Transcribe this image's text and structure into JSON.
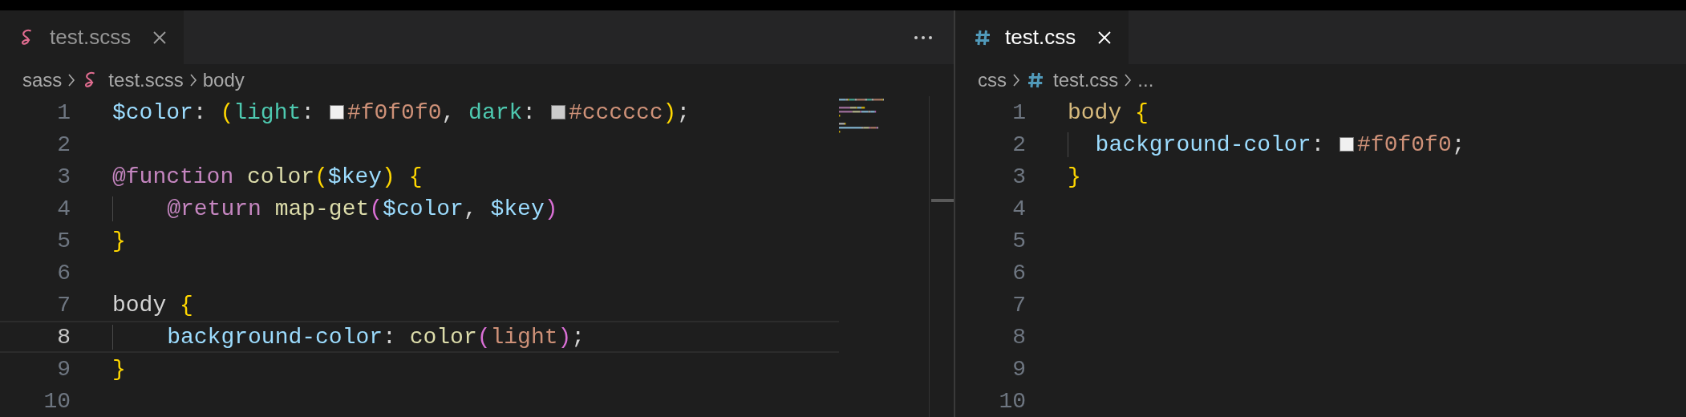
{
  "editor_groups": [
    {
      "focused": false,
      "more_actions": true,
      "minimap": true,
      "tabs": [
        {
          "label": "test.scss",
          "kind": "sass",
          "selected": true
        }
      ],
      "breadcrumbs": [
        {
          "label": "sass",
          "kind": "folder"
        },
        {
          "label": "test.scss",
          "kind": "sass"
        },
        {
          "label": "body",
          "kind": "symbol"
        }
      ],
      "lines": [
        {
          "number": "1",
          "current": false,
          "guide": false,
          "tokens": [
            {
              "kind": "variable",
              "text": "$color"
            },
            {
              "kind": "punct",
              "text": ": "
            },
            {
              "kind": "bracket1",
              "text": "("
            },
            {
              "kind": "mapkey",
              "text": "light"
            },
            {
              "kind": "punct",
              "text": ": "
            },
            {
              "kind": "swatch",
              "color": "#f0f0f0"
            },
            {
              "kind": "value",
              "text": "#f0f0f0"
            },
            {
              "kind": "punct",
              "text": ", "
            },
            {
              "kind": "mapkey",
              "text": "dark"
            },
            {
              "kind": "punct",
              "text": ": "
            },
            {
              "kind": "swatch",
              "color": "#cccccc"
            },
            {
              "kind": "value",
              "text": "#cccccc"
            },
            {
              "kind": "bracket1",
              "text": ")"
            },
            {
              "kind": "punct",
              "text": ";"
            }
          ]
        },
        {
          "number": "2",
          "current": false,
          "guide": false
        },
        {
          "number": "3",
          "current": false,
          "guide": false,
          "tokens": [
            {
              "kind": "atrule",
              "text": "@function "
            },
            {
              "kind": "function",
              "text": "color"
            },
            {
              "kind": "bracket1",
              "text": "("
            },
            {
              "kind": "variable",
              "text": "$key"
            },
            {
              "kind": "bracket1",
              "text": ") {"
            }
          ]
        },
        {
          "number": "4",
          "current": false,
          "guide": true,
          "tokens": [
            {
              "kind": "atrule",
              "text": "    @return "
            },
            {
              "kind": "function",
              "text": "map-get"
            },
            {
              "kind": "bracket2",
              "text": "("
            },
            {
              "kind": "variable",
              "text": "$color"
            },
            {
              "kind": "punct",
              "text": ", "
            },
            {
              "kind": "variable",
              "text": "$key"
            },
            {
              "kind": "bracket2",
              "text": ")"
            }
          ]
        },
        {
          "number": "5",
          "current": false,
          "guide": false,
          "tokens": [
            {
              "kind": "bracket1",
              "text": "}"
            }
          ]
        },
        {
          "number": "6",
          "current": false,
          "guide": false
        },
        {
          "number": "7",
          "current": false,
          "guide": false,
          "tokens": [
            {
              "kind": "plain",
              "text": "body "
            },
            {
              "kind": "bracket1",
              "text": "{"
            }
          ]
        },
        {
          "number": "8",
          "current": true,
          "guide": true,
          "tokens": [
            {
              "kind": "property",
              "text": "    background-color"
            },
            {
              "kind": "punct",
              "text": ": "
            },
            {
              "kind": "function",
              "text": "color"
            },
            {
              "kind": "bracket2",
              "text": "("
            },
            {
              "kind": "value",
              "text": "light"
            },
            {
              "kind": "bracket2",
              "text": ")"
            },
            {
              "kind": "punct",
              "text": ";"
            }
          ]
        },
        {
          "number": "9",
          "current": false,
          "guide": false,
          "tokens": [
            {
              "kind": "bracket1",
              "text": "}"
            }
          ]
        },
        {
          "number": "10",
          "current": false,
          "guide": false
        }
      ]
    },
    {
      "focused": true,
      "more_actions": false,
      "minimap": false,
      "tabs": [
        {
          "label": "test.css",
          "kind": "css",
          "selected": true
        }
      ],
      "breadcrumbs": [
        {
          "label": "css",
          "kind": "folder"
        },
        {
          "label": "test.css",
          "kind": "css"
        },
        {
          "label": "...",
          "kind": "folder"
        }
      ],
      "lines": [
        {
          "number": "1",
          "current": false,
          "guide": false,
          "tokens": [
            {
              "kind": "selector",
              "text": "body "
            },
            {
              "kind": "bracket1",
              "text": "{"
            }
          ]
        },
        {
          "number": "2",
          "current": false,
          "guide": true,
          "tokens": [
            {
              "kind": "property",
              "text": "  background-color"
            },
            {
              "kind": "punct",
              "text": ": "
            },
            {
              "kind": "swatch",
              "color": "#f0f0f0"
            },
            {
              "kind": "value",
              "text": "#f0f0f0"
            },
            {
              "kind": "punct",
              "text": ";"
            }
          ]
        },
        {
          "number": "3",
          "current": false,
          "guide": false,
          "tokens": [
            {
              "kind": "bracket1",
              "text": "}"
            }
          ]
        },
        {
          "number": "4",
          "current": false,
          "guide": false
        },
        {
          "number": "5",
          "current": false,
          "guide": false
        },
        {
          "number": "6",
          "current": false,
          "guide": false
        },
        {
          "number": "7",
          "current": false,
          "guide": false
        },
        {
          "number": "8",
          "current": false,
          "guide": false
        },
        {
          "number": "9",
          "current": false,
          "guide": false
        },
        {
          "number": "10",
          "current": false,
          "guide": false
        }
      ]
    }
  ]
}
